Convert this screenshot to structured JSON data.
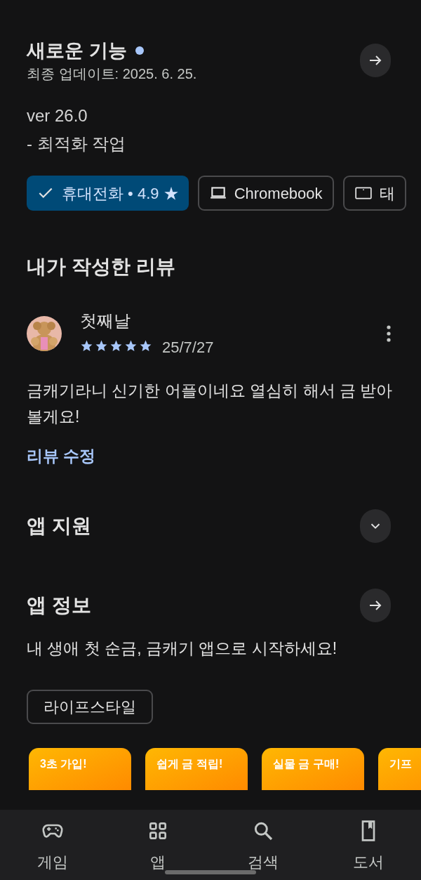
{
  "whats_new": {
    "title": "새로운 기능",
    "new_badge": true,
    "updated": "최종 업데이트: 2025. 6. 25.",
    "notes": [
      "ver 26.0",
      "- 최적화 작업"
    ]
  },
  "device_chips": [
    {
      "label": "휴대전화 • 4.9 ★",
      "selected": true
    },
    {
      "kind": "laptop",
      "label": "Chromebook",
      "selected": false
    },
    {
      "kind": "tablet",
      "label": "태",
      "selected": false
    }
  ],
  "my_review": {
    "heading": "내가 작성한 리뷰",
    "author": "첫째날",
    "stars": 5,
    "date": "25/7/27",
    "text": "금캐기라니 신기한 어플이네요 열심히 해서 금 받아볼게요!",
    "edit_link": "리뷰 수정"
  },
  "app_support": {
    "heading": "앱 지원",
    "expanded": false
  },
  "app_info": {
    "heading": "앱 정보",
    "description": "내 생애 첫 순금, 금캐기 앱으로 시작하세요!",
    "tags": [
      "라이프스타일"
    ]
  },
  "screenshots": [
    {
      "caption": "3초 가입!"
    },
    {
      "caption": "쉽게 금 적립!"
    },
    {
      "caption": "실물 금 구매!"
    },
    {
      "caption": "기프"
    }
  ],
  "bottom_nav": [
    {
      "kind": "games",
      "label": "게임",
      "selected": false
    },
    {
      "kind": "apps",
      "label": "앱",
      "selected": false
    },
    {
      "kind": "search",
      "label": "검색",
      "selected": false
    },
    {
      "kind": "books",
      "label": "도서",
      "selected": false
    }
  ]
}
